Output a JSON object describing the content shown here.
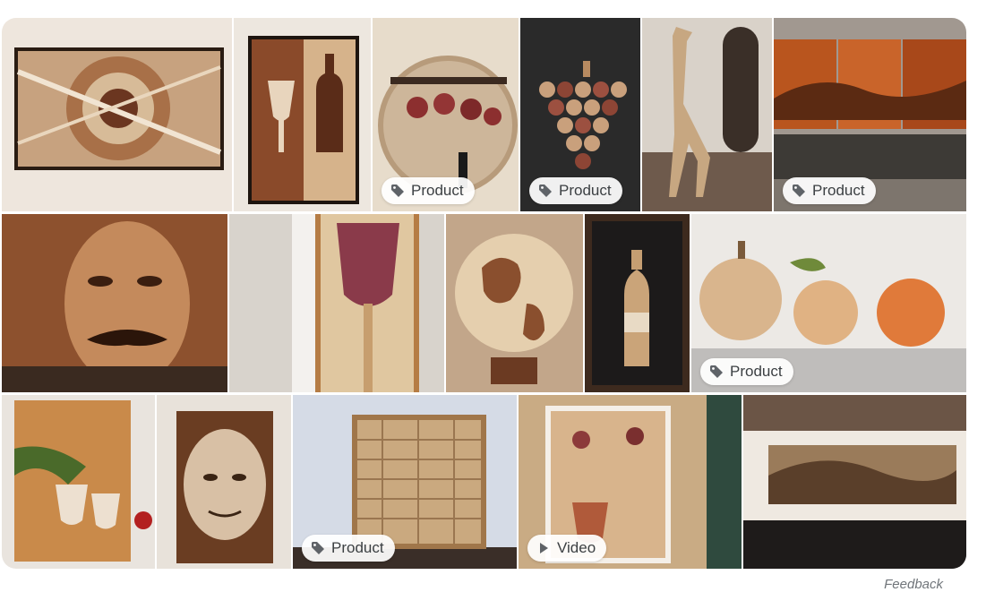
{
  "results": [
    {
      "alt": "cork wine art sun",
      "badge": null
    },
    {
      "alt": "cork wine glass bottle frame",
      "badge": null
    },
    {
      "alt": "cork grapes round board",
      "badge": "Product"
    },
    {
      "alt": "cork grape cluster",
      "badge": "Product"
    },
    {
      "alt": "cork giraffe sculpture",
      "badge": null
    },
    {
      "alt": "cork landscape triptych",
      "badge": "Product"
    },
    {
      "alt": "cork portrait mustache man",
      "badge": null
    },
    {
      "alt": "cork wine glass panel",
      "badge": null
    },
    {
      "alt": "cork globe",
      "badge": null
    },
    {
      "alt": "cork bottle shadow box",
      "badge": null
    },
    {
      "alt": "cork pumpkins",
      "badge": "Product"
    },
    {
      "alt": "cork wine pour mosaic",
      "badge": null
    },
    {
      "alt": "cork portrait elderly woman",
      "badge": null
    },
    {
      "alt": "cork board panel",
      "badge": "Product"
    },
    {
      "alt": "cork grapes mosaic video",
      "badge": "Video"
    },
    {
      "alt": "cork mural wall",
      "badge": null
    }
  ],
  "feedback_label": "Feedback",
  "colors": {
    "badge_text": "#3c4043",
    "feedback": "#70757a"
  },
  "icons": {
    "product": "tag-icon",
    "video": "play-icon"
  }
}
